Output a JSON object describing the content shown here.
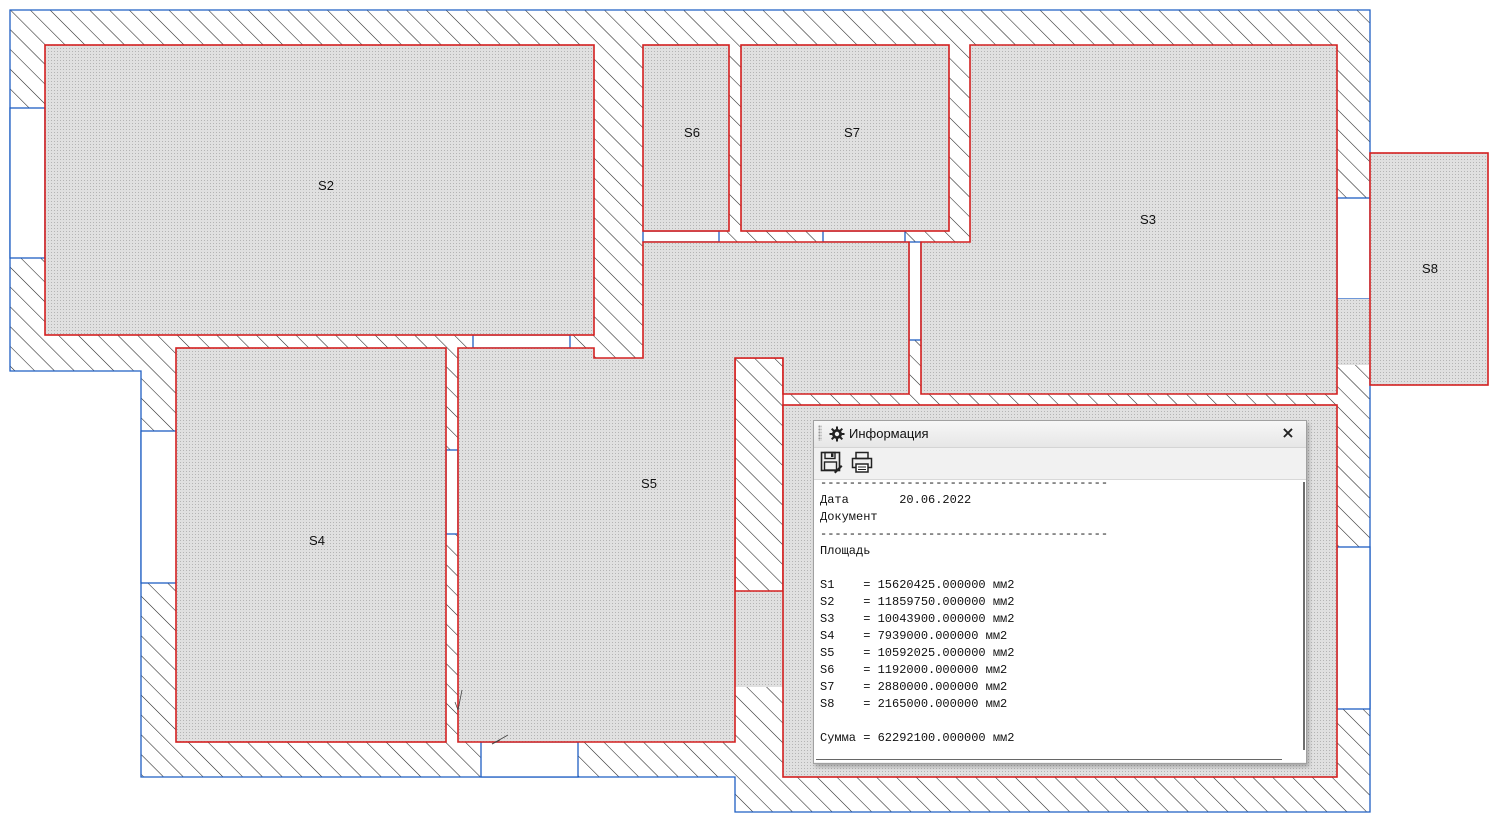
{
  "rooms": [
    {
      "id": "S2",
      "label": "S2"
    },
    {
      "id": "S3",
      "label": "S3"
    },
    {
      "id": "S4",
      "label": "S4"
    },
    {
      "id": "S5",
      "label": "S5"
    },
    {
      "id": "S6",
      "label": "S6"
    },
    {
      "id": "S7",
      "label": "S7"
    },
    {
      "id": "S8",
      "label": "S8"
    }
  ],
  "colors": {
    "wall_outline": "#1f5fc4",
    "room_outline": "#d42020",
    "room_fill": "#d8d8d8",
    "hatch": "#222222"
  },
  "info_panel": {
    "title": "Информация",
    "icons": {
      "title": "gear-icon",
      "save": "save-icon",
      "print": "printer-icon",
      "close": "close-icon"
    },
    "close_glyph": "×",
    "lines": [
      "----------------------------------------",
      "Дата       20.06.2022",
      "Документ",
      "----------------------------------------",
      "Площадь",
      "",
      "S1    = 15620425.000000 мм2",
      "S2    = 11859750.000000 мм2",
      "S3    = 10043900.000000 мм2",
      "S4    = 7939000.000000 мм2",
      "S5    = 10592025.000000 мм2",
      "S6    = 1192000.000000 мм2",
      "S7    = 2880000.000000 мм2",
      "S8    = 2165000.000000 мм2",
      "",
      "Сумма = 62292100.000000 мм2"
    ]
  }
}
